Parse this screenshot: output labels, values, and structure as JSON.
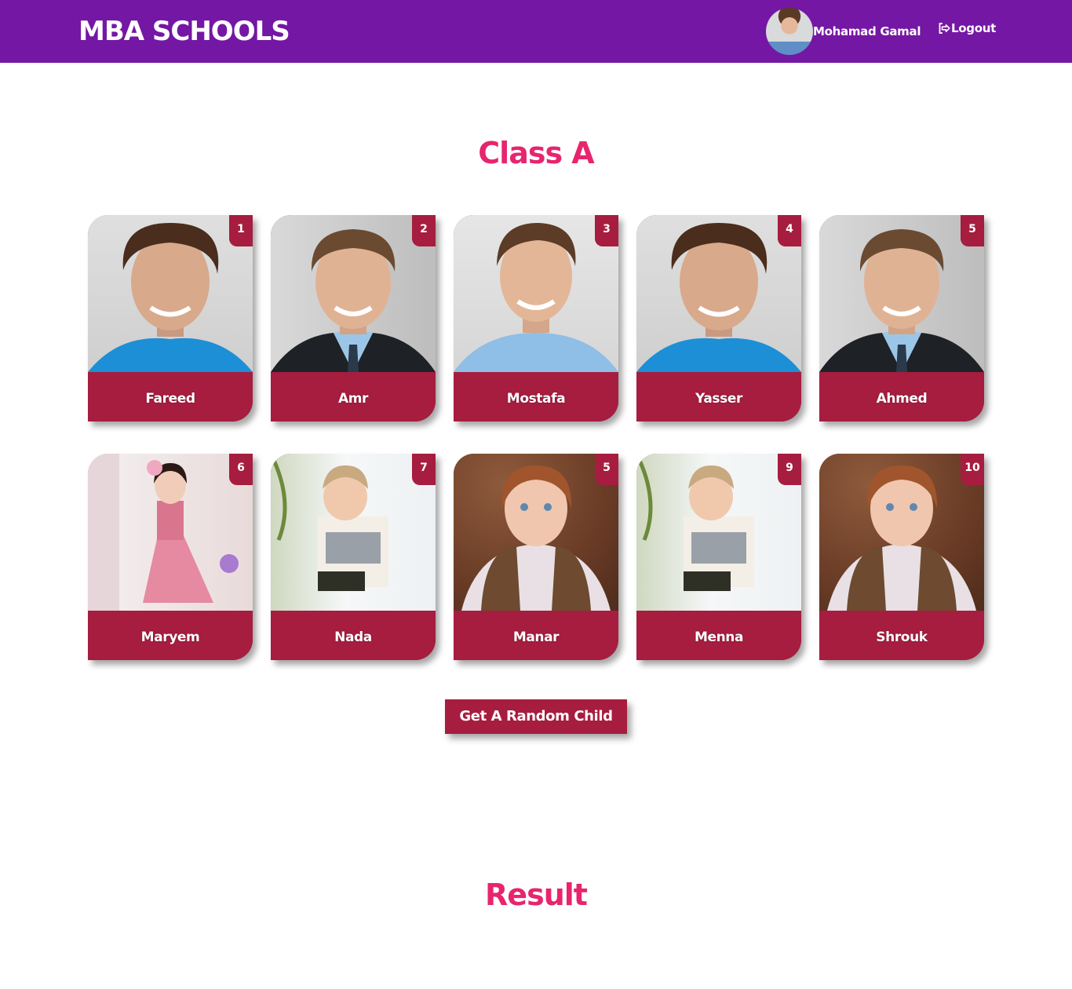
{
  "navbar": {
    "brand": "MBA SCHOOLS",
    "user_name": "Mohamad Gamal",
    "logout_label": "Logout",
    "color": "#7417a4"
  },
  "class_title": "Class A",
  "result_title": "Result",
  "random_button": "Get A Random Child",
  "accent_color": "#a61d3f",
  "title_color": "#e7256e",
  "children": [
    {
      "number": "1",
      "name": "Fareed",
      "photo": "man-curly-blue-shirt"
    },
    {
      "number": "2",
      "name": "Amr",
      "photo": "man-suit-tie"
    },
    {
      "number": "3",
      "name": "Mostafa",
      "photo": "man-blue-shirt"
    },
    {
      "number": "4",
      "name": "Yasser",
      "photo": "man-curly-blue-shirt"
    },
    {
      "number": "5",
      "name": "Ahmed",
      "photo": "man-suit-tie"
    },
    {
      "number": "6",
      "name": "Maryem",
      "photo": "girl-pink-dress"
    },
    {
      "number": "7",
      "name": "Nada",
      "photo": "baby-happy-baby-shirt"
    },
    {
      "number": "5",
      "name": "Manar",
      "photo": "girl-fur-vest"
    },
    {
      "number": "9",
      "name": "Menna",
      "photo": "baby-happy-baby-shirt"
    },
    {
      "number": "10",
      "name": "Shrouk",
      "photo": "girl-fur-vest"
    }
  ]
}
